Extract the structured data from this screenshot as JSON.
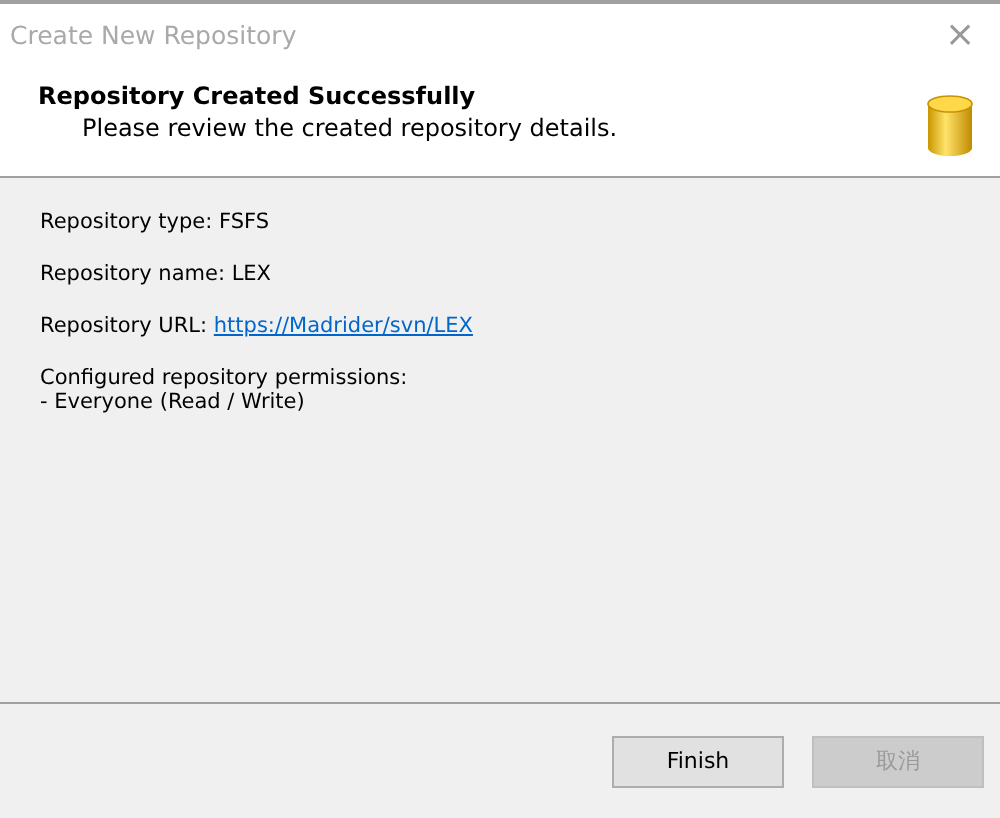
{
  "window": {
    "title": "Create New Repository",
    "close": "×"
  },
  "header": {
    "title": "Repository Created Successfully",
    "subtitle": "Please review the created repository details."
  },
  "details": [
    {
      "kind": "text",
      "label": "Repository type: FSFS"
    },
    {
      "kind": "text",
      "label": "Repository name: LEX"
    },
    {
      "kind": "link",
      "label": "Repository URL: ",
      "link": "https://Madrider/svn/LEX"
    },
    {
      "kind": "lines",
      "lines": [
        "Configured repository permissions:",
        "- Everyone (Read / Write)"
      ]
    }
  ],
  "buttons": [
    {
      "label": "Finish",
      "disabled": false
    },
    {
      "label": "取消",
      "disabled": true
    }
  ]
}
